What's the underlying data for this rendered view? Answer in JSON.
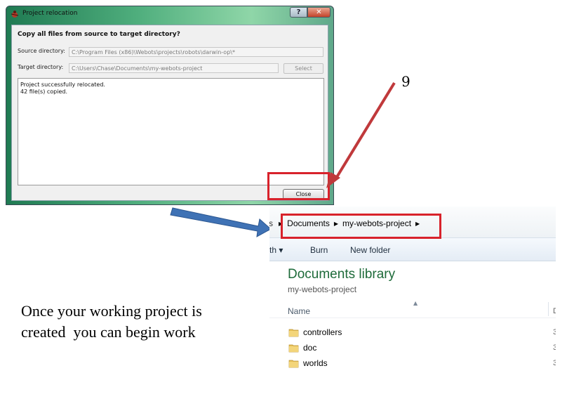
{
  "dialog": {
    "title": "Project relocation",
    "help_glyph": "?",
    "close_glyph": "✕",
    "heading": "Copy all files from source to target directory?",
    "source_label": "Source directory:",
    "source_value": "C:\\Program Files (x86)\\Webots\\projects\\robots\\darwin-op\\*",
    "target_label": "Target directory:",
    "target_value": "C:\\Users\\Chase\\Documents\\my-webots-project",
    "select_label": "Select",
    "log_lines": [
      "Project successfully relocated.",
      "42 file(s) copied."
    ],
    "close_label": "Close"
  },
  "annotation": {
    "step_number": "9",
    "caption_lines": [
      "Once your working project is",
      "created  you can begin work"
    ],
    "arrow_red_color": "#c0393b",
    "arrow_blue_color": "#3f72b5",
    "highlight_color": "#d8222b"
  },
  "explorer": {
    "breadcrumb_prefix": "s",
    "breadcrumb": [
      "Documents",
      "my-webots-project"
    ],
    "toolbar_items": [
      "th ▾",
      "Burn",
      "New folder"
    ],
    "library_title": "Documents library",
    "library_subtitle": "my-webots-project",
    "column_name": "Name",
    "column_edge": "D",
    "folders": [
      "controllers",
      "doc",
      "worlds"
    ],
    "row_edge": "3"
  }
}
